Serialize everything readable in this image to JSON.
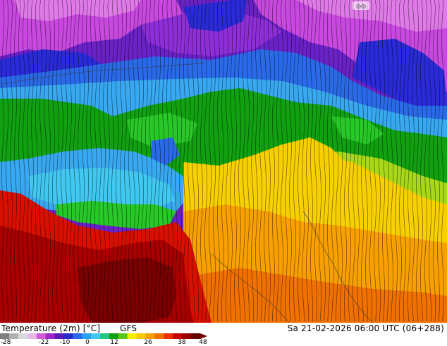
{
  "title": "Temperature (2m) [°C]",
  "model": "GFS",
  "valid_time": "Sa 21-02-2026 06:00 UTC (06+288)",
  "scale": {
    "ticks": [
      "-28",
      "-22",
      "-10",
      "0",
      "12",
      "26",
      "38",
      "48"
    ],
    "colors": [
      "#7f7f7f",
      "#b0b0b0",
      "#d9d9d9",
      "#e9b8e9",
      "#d25cd2",
      "#a226c8",
      "#5a18b8",
      "#2a2ac8",
      "#2a6ae8",
      "#2aa0f0",
      "#40c8f0",
      "#20c880",
      "#10a010",
      "#58c818",
      "#f0f000",
      "#f8c800",
      "#f8a000",
      "#f07000",
      "#e83000",
      "#c80000",
      "#960000",
      "#6a0000"
    ]
  },
  "map_colors": {
    "cold_purple": "#6a22c8",
    "violet": "#8e2ed8",
    "magenta": "#c848e0",
    "pink": "#e07ae8",
    "deep_blue": "#2a2ad8",
    "blue": "#2a6ae8",
    "light_blue": "#38a8f0",
    "cyan": "#40c8f0",
    "green": "#10a010",
    "bright_green": "#28c828",
    "yellow_green": "#a8d818",
    "yellow": "#f8d000",
    "orange": "#f8a000",
    "dark_orange": "#f07000",
    "red": "#d81000",
    "dark_red": "#a80000",
    "maroon": "#780000"
  }
}
